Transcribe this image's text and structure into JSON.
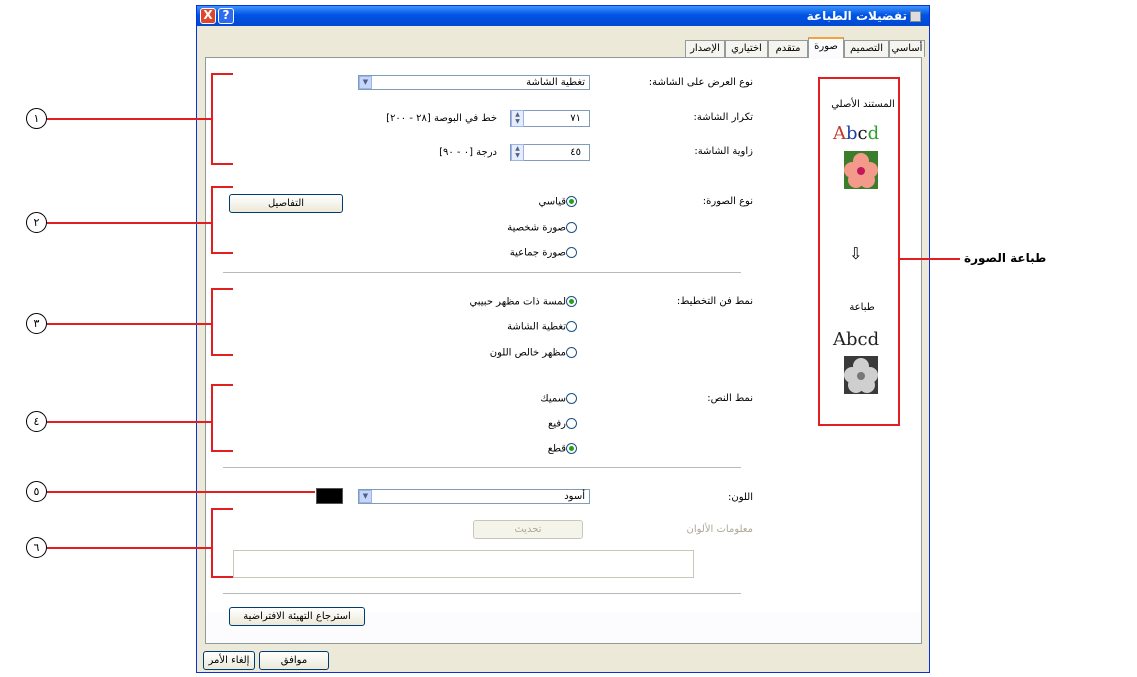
{
  "window": {
    "title": "تفضيلات الطباعة",
    "close_glyph": "X",
    "help_glyph": "?"
  },
  "tabs": [
    {
      "label": "أساسي"
    },
    {
      "label": "التصميم"
    },
    {
      "label": "صورة"
    },
    {
      "label": "متقدم"
    },
    {
      "label": "اختياري"
    },
    {
      "label": "الإصدار"
    }
  ],
  "screen": {
    "type_label": "نوع العرض على الشاشة:",
    "type_value": "تغطية الشاشة",
    "frequency_label": "تكرار الشاشة:",
    "frequency_value": "٧١",
    "frequency_unit": "خط في البوصة [٢٨ - ٢٠٠]",
    "angle_label": "زاوية الشاشة:",
    "angle_value": "٤٥",
    "angle_unit": "درجة [٠ - ٩٠]"
  },
  "image_type": {
    "label": "نوع الصورة:",
    "options": [
      "قياسي",
      "صورة شخصية",
      "صورة جماعية"
    ],
    "selected": 0,
    "details_button": "التفاصيل"
  },
  "layout_style": {
    "label": "نمط فن التخطيط:",
    "options": [
      "لمسة ذات مظهر حبيبي",
      "تغطية الشاشة",
      "مظهر خالص اللون"
    ],
    "selected": 0
  },
  "text_style": {
    "label": "نمط النص:",
    "options": [
      "سميك",
      "رفيع",
      "قطع"
    ],
    "selected": 2
  },
  "color": {
    "label": "اللون:",
    "value": "أسود",
    "swatch": "#000000",
    "info_label": "معلومات الألوان",
    "update_button": "تحديث"
  },
  "restore_button": "استرجاع التهيئة الافتراضية",
  "ok_button": "موافق",
  "cancel_button": "إلغاء الأمر",
  "preview": {
    "original_label": "المستند الأصلي",
    "print_label": "طباعة",
    "sample_text": "Abcd",
    "arrow": "⇩"
  },
  "callouts": [
    "١",
    "٢",
    "٣",
    "٤",
    "٥",
    "٦"
  ],
  "annotation_label": "طباعة الصورة",
  "colors": {
    "highlight": "#e02020",
    "titlebar": "#0054e3"
  }
}
